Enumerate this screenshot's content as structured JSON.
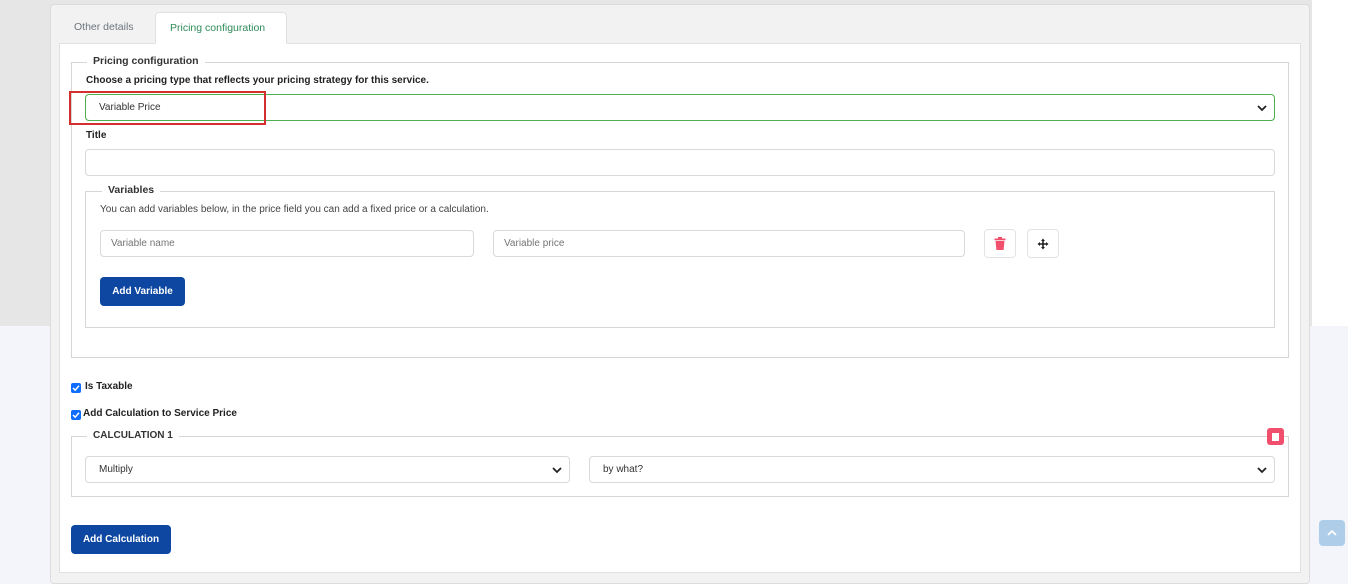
{
  "tabs": [
    {
      "label": "Other details"
    },
    {
      "label": "Pricing configuration"
    }
  ],
  "pricing": {
    "legend": "Pricing configuration",
    "help": "Choose a pricing type that reflects your pricing strategy for this service.",
    "type_value": "Variable Price",
    "title_label": "Title",
    "title_value": ""
  },
  "variables": {
    "legend": "Variables",
    "help": "You can add variables below, in the price field you can add a fixed price or a calculation.",
    "name_placeholder": "Variable name",
    "price_placeholder": "Variable price",
    "add_label": "Add Variable"
  },
  "options": {
    "taxable_label": "Is Taxable",
    "taxable_checked": true,
    "add_calc_label": "Add Calculation to Service Price",
    "add_calc_checked": true
  },
  "calculation": {
    "legend": "CALCULATION 1",
    "operation_value": "Multiply",
    "operand_value": "by what?",
    "add_label": "Add Calculation"
  },
  "colors": {
    "primary": "#0d47a1",
    "active_tab": "#2e8b57",
    "delete": "#f0506e",
    "highlight": "#d32f2f"
  }
}
